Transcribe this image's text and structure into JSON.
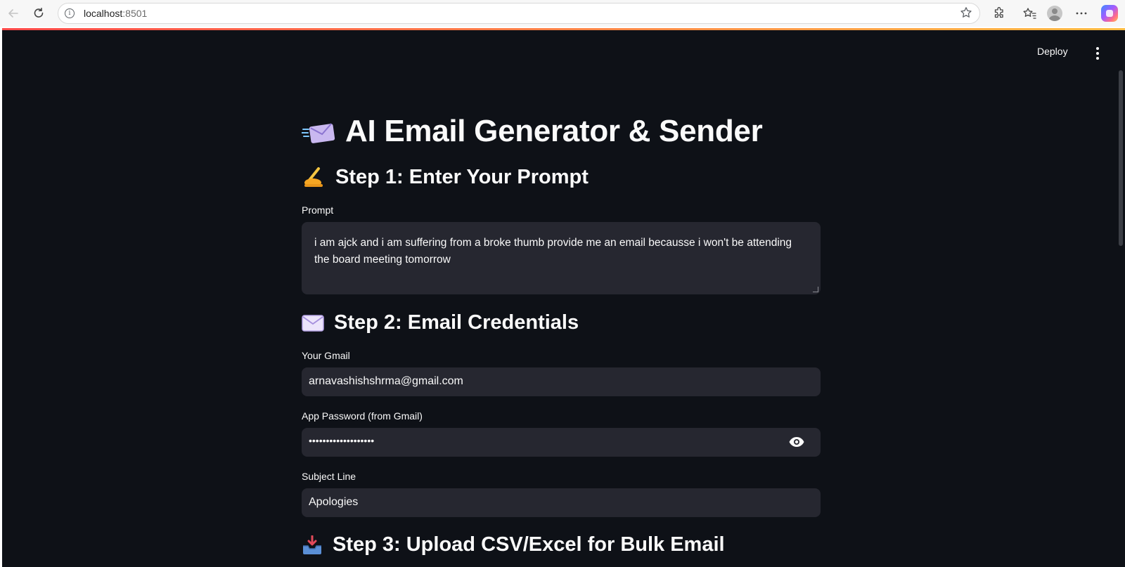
{
  "browser": {
    "url_host": "localhost",
    "url_port": ":8501"
  },
  "header": {
    "deploy_label": "Deploy"
  },
  "page": {
    "title": "AI Email Generator & Sender",
    "step1_heading": "Step 1: Enter Your Prompt",
    "step2_heading": "Step 2: Email Credentials",
    "step3_heading": "Step 3: Upload CSV/Excel for Bulk Email"
  },
  "form": {
    "prompt": {
      "label": "Prompt",
      "value": "i am ajck and i am suffering from a broke thumb provide me an email becausse i won't be attending the board meeting tomorrow"
    },
    "gmail": {
      "label": "Your Gmail",
      "value": "arnavashishshrma@gmail.com"
    },
    "app_password": {
      "label": "App Password (from Gmail)",
      "value": "•••••••••••••••••••"
    },
    "subject": {
      "label": "Subject Line",
      "value": "Apologies"
    }
  },
  "colors": {
    "app_background": "#0e1117",
    "input_background": "#262730",
    "text": "#fafafa"
  },
  "icons": {
    "title": "incoming-envelope-icon",
    "step1": "writing-hand-icon",
    "step2": "envelope-icon",
    "step3": "inbox-tray-icon",
    "password_toggle": "eye-icon"
  }
}
